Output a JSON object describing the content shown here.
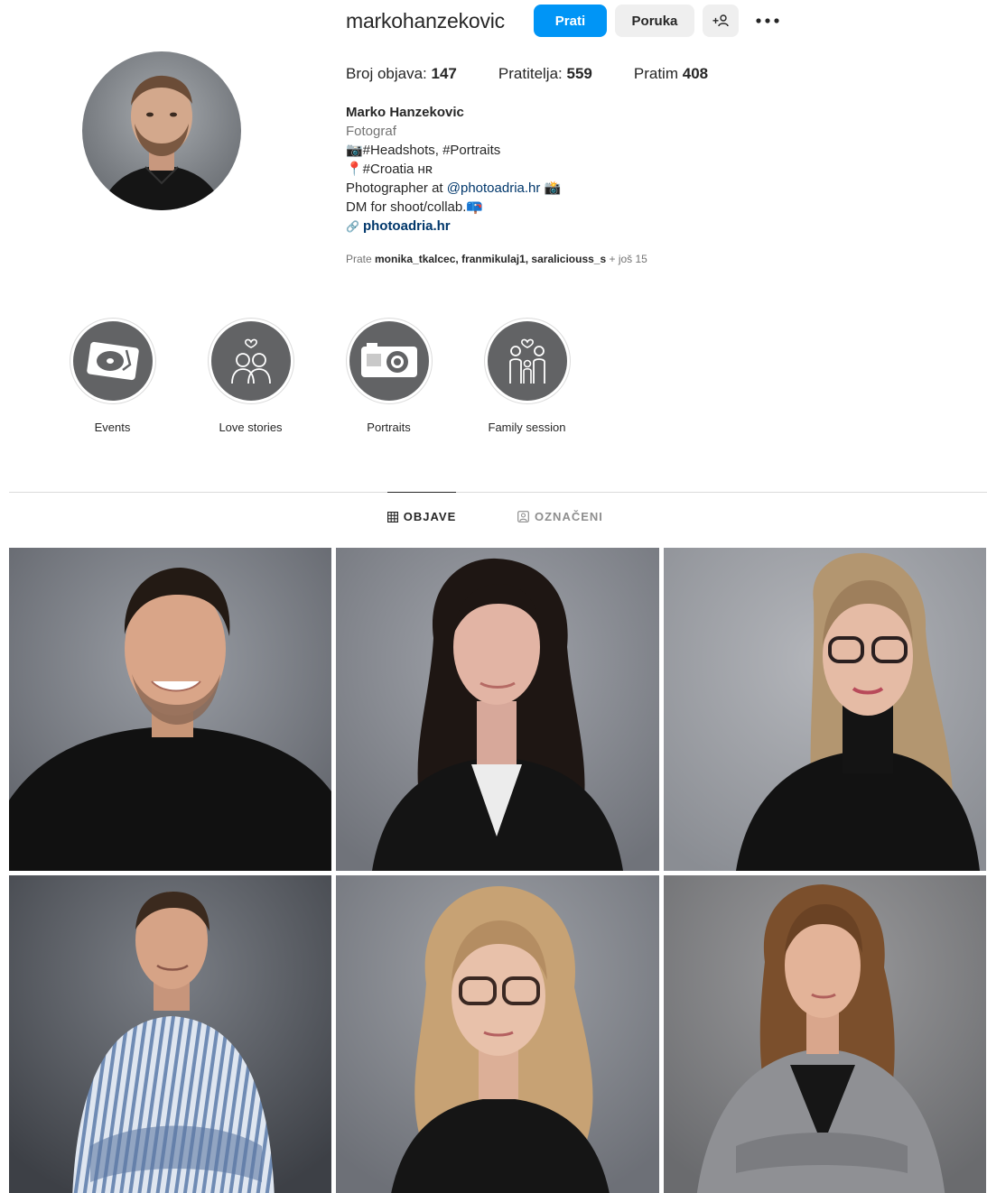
{
  "profile": {
    "username": "markohanzekovic",
    "follow_label": "Prati",
    "message_label": "Poruka",
    "add_user_label": "+ā",
    "more_label": "•••",
    "stats": {
      "posts_label": "Broj objava:",
      "posts_count": "147",
      "followers_label": "Pratitelja:",
      "followers_count": "559",
      "following_label": "Pratim",
      "following_count": "408"
    },
    "bio": {
      "name": "Marko Hanzekovic",
      "category": "Fotograf",
      "line1": "📷#Headshots, #Portraits",
      "line2": "📍#Croatia ʜʀ",
      "line3_prefix": "Photographer at ",
      "line3_mention": "@photoadria.hr",
      "line3_suffix": " 📸",
      "line4": "DM for shoot/collab.📪",
      "link": "photoadria.hr"
    },
    "followed_by": {
      "prefix": "Prate ",
      "names": "monika_tkalcec, franmikulaj1, saraliciouss_s",
      "suffix": " + još 15"
    }
  },
  "highlights": [
    {
      "label": "Events",
      "icon": "turntable-icon"
    },
    {
      "label": "Love stories",
      "icon": "couple-icon"
    },
    {
      "label": "Portraits",
      "icon": "camera-icon"
    },
    {
      "label": "Family session",
      "icon": "family-icon"
    }
  ],
  "tabs": {
    "posts": "OBJAVE",
    "tagged": "OZNAČENI"
  },
  "colors": {
    "accent": "#0095f6",
    "button_gray": "#efefef",
    "highlight_bg": "#626365"
  }
}
